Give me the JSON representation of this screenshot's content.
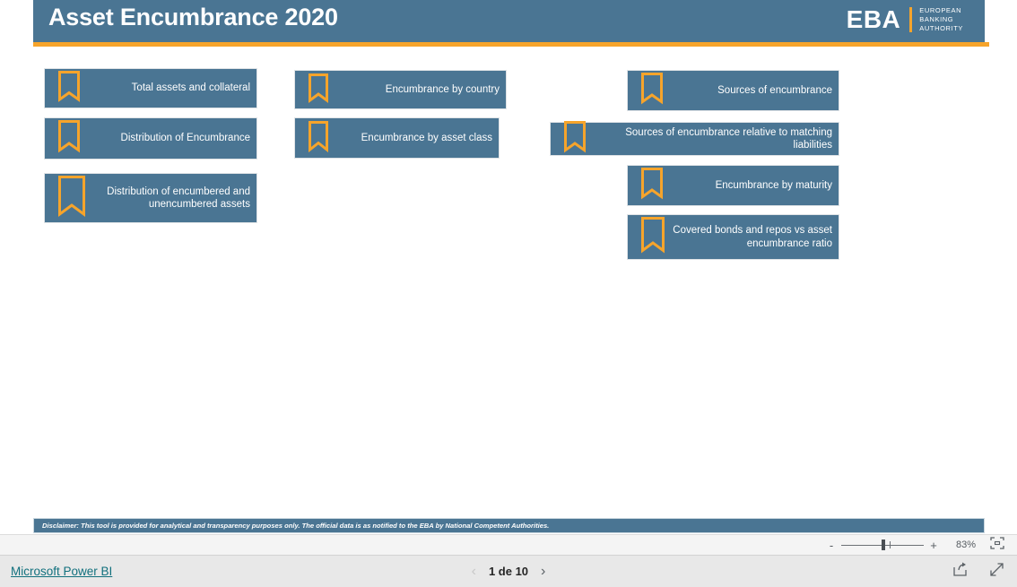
{
  "report": {
    "title": "Asset Encumbrance 2020",
    "logo": {
      "word": "EBA",
      "line1": "EUROPEAN",
      "line2": "BANKING",
      "line3": "AUTHORITY"
    },
    "disclaimer": "Disclaimer: This tool is provided for analytical and transparency purposes only. The official data is as notified to the EBA by National Competent Authorities."
  },
  "bookmarks": [
    {
      "label": "Total assets and collateral"
    },
    {
      "label": "Distribution of Encumbrance"
    },
    {
      "label": "Distribution of encumbered and unencumbered assets"
    },
    {
      "label": "Encumbrance by country"
    },
    {
      "label": "Encumbrance by asset class"
    },
    {
      "label": "Sources of encumbrance"
    },
    {
      "label": "Sources of encumbrance relative to matching liabilities"
    },
    {
      "label": "Encumbrance by maturity"
    },
    {
      "label": "Covered bonds and repos vs asset encumbrance ratio"
    }
  ],
  "zoombar": {
    "minus_label": "-",
    "plus_label": "+",
    "zoom_level": "83%",
    "fit_icon": "fit-to-page-icon"
  },
  "footer": {
    "powerbi_link": "Microsoft Power BI",
    "prev_arrow": "‹",
    "next_arrow": "›",
    "page_label": "1 de 10",
    "share_icon": "share-icon",
    "fullscreen_icon": "fullscreen-icon"
  },
  "colors": {
    "brand_blue": "#4a7593",
    "brand_orange": "#f6a42b",
    "link_teal": "#11707d"
  }
}
